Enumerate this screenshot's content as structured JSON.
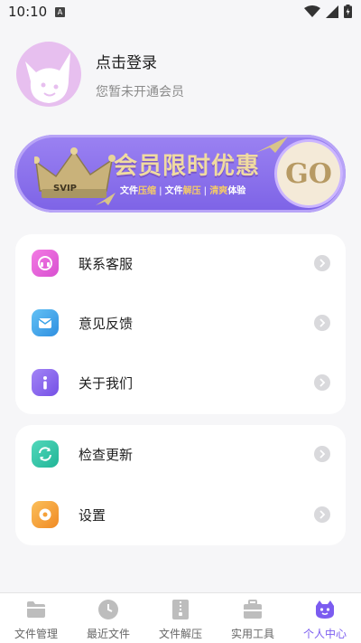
{
  "status": {
    "time": "10:10",
    "badge": "A"
  },
  "profile": {
    "title": "点击登录",
    "subtitle": "您暂未开通会员"
  },
  "vip": {
    "title": "会员限时优惠",
    "crown_text": "SVIP",
    "tags": [
      {
        "plain": "文件",
        "highlight": "压缩"
      },
      {
        "plain": "文件",
        "highlight": "解压"
      },
      {
        "plain": "",
        "highlight": "清爽",
        "suffix": "体验"
      }
    ],
    "go": "GO"
  },
  "menu_group_1": [
    {
      "label": "联系客服",
      "icon": "headset-icon",
      "color": "#e65bd6"
    },
    {
      "label": "意见反馈",
      "icon": "feedback-icon",
      "color": "#3aa3e8"
    },
    {
      "label": "关于我们",
      "icon": "info-icon",
      "color": "#8a63ee"
    }
  ],
  "menu_group_2": [
    {
      "label": "检查更新",
      "icon": "refresh-icon",
      "color": "#2fc4a6"
    },
    {
      "label": "设置",
      "icon": "settings-icon",
      "color": "#f5a13a"
    }
  ],
  "bottom_nav": [
    {
      "label": "文件管理",
      "icon": "folder-icon",
      "active": false
    },
    {
      "label": "最近文件",
      "icon": "clock-icon",
      "active": false
    },
    {
      "label": "文件解压",
      "icon": "zip-icon",
      "active": false
    },
    {
      "label": "实用工具",
      "icon": "toolbox-icon",
      "active": false
    },
    {
      "label": "个人中心",
      "icon": "user-face-icon",
      "active": true
    }
  ],
  "colors": {
    "accent": "#7b5cf0",
    "background": "#f6f6f8",
    "vip_gold": "#f0dba0"
  }
}
